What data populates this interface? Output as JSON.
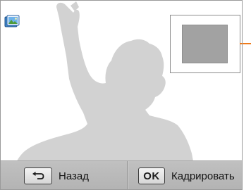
{
  "screen": {
    "title_icon": "photo-album-icon",
    "crop_preview": {
      "highlight_color": "#ee7a1a"
    }
  },
  "bottom_bar": {
    "back": {
      "icon": "return-arrow-icon",
      "label": "Назад"
    },
    "ok": {
      "key_label": "OK",
      "label": "Кадрировать"
    }
  }
}
